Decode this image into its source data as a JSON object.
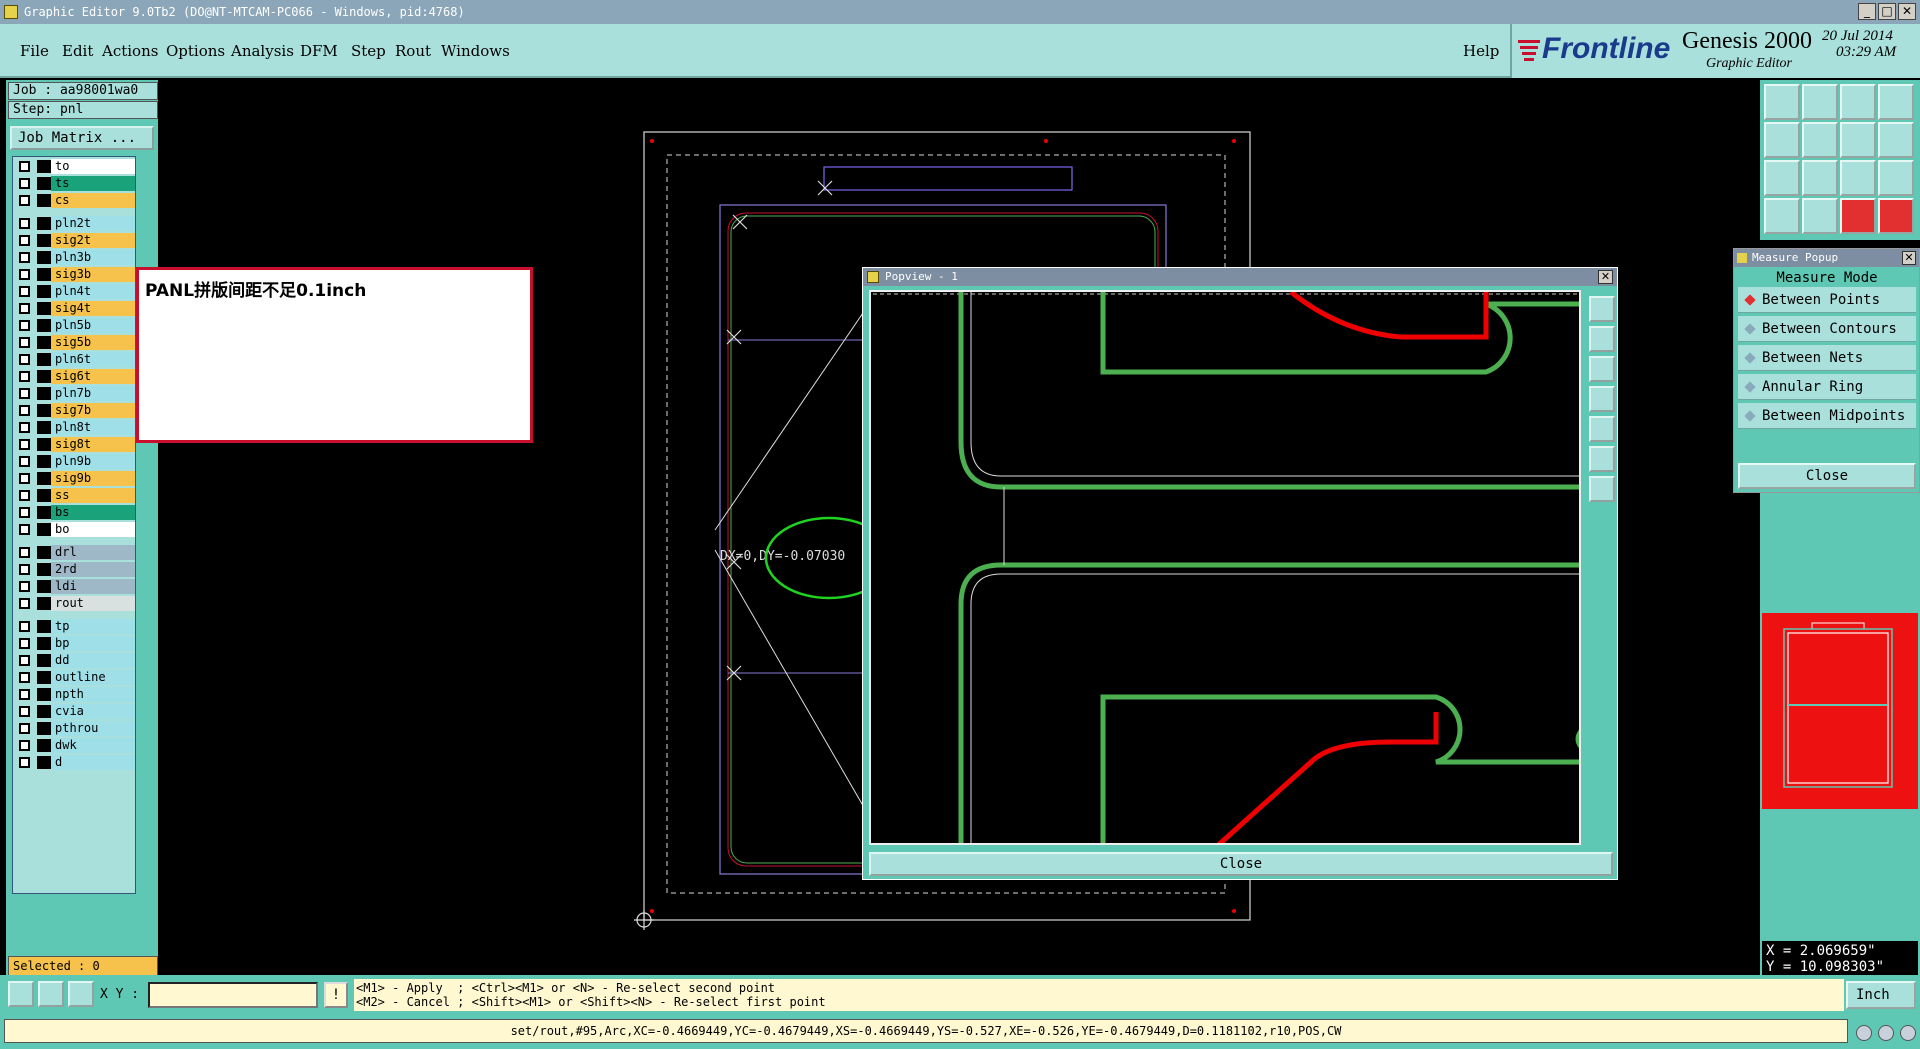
{
  "window": {
    "title": "Graphic Editor 9.0Tb2 (DO@NT-MTCAM-PC066 - Windows, pid:4768)"
  },
  "menu": {
    "items": [
      "File",
      "Edit",
      "Actions",
      "Options",
      "Analysis",
      "DFM",
      "Step",
      "Rout",
      "Windows"
    ],
    "help": "Help"
  },
  "brand": {
    "logo": "Frontline",
    "product": "Genesis 2000",
    "subtitle": "Graphic Editor",
    "date": "20 Jul 2014",
    "time": "03:29 AM"
  },
  "job": {
    "job_label": "Job : aa98001wa0",
    "step_label": "Step: pnl",
    "matrix_button": "Job Matrix ..."
  },
  "layers": [
    {
      "name": "to",
      "color": "#ffffff"
    },
    {
      "name": "ts",
      "color": "#1aa37a"
    },
    {
      "name": "cs",
      "color": "#f6c24c"
    },
    {
      "name": "pln2t",
      "color": "#9fdfe8"
    },
    {
      "name": "sig2t",
      "color": "#f6c24c"
    },
    {
      "name": "pln3b",
      "color": "#9fdfe8"
    },
    {
      "name": "sig3b",
      "color": "#f6c24c"
    },
    {
      "name": "pln4t",
      "color": "#9fdfe8"
    },
    {
      "name": "sig4t",
      "color": "#f6c24c"
    },
    {
      "name": "pln5b",
      "color": "#9fdfe8"
    },
    {
      "name": "sig5b",
      "color": "#f6c24c"
    },
    {
      "name": "pln6t",
      "color": "#9fdfe8"
    },
    {
      "name": "sig6t",
      "color": "#f6c24c"
    },
    {
      "name": "pln7b",
      "color": "#9fdfe8"
    },
    {
      "name": "sig7b",
      "color": "#f6c24c"
    },
    {
      "name": "pln8t",
      "color": "#9fdfe8"
    },
    {
      "name": "sig8t",
      "color": "#f6c24c"
    },
    {
      "name": "pln9b",
      "color": "#9fdfe8"
    },
    {
      "name": "sig9b",
      "color": "#f6c24c"
    },
    {
      "name": "ss",
      "color": "#f6c24c"
    },
    {
      "name": "bs",
      "color": "#1aa37a"
    },
    {
      "name": "bo",
      "color": "#ffffff"
    },
    {
      "name": "drl",
      "color": "#9fb8c8"
    },
    {
      "name": "2rd",
      "color": "#9fb8c8"
    },
    {
      "name": "ldi",
      "color": "#9fb8c8"
    },
    {
      "name": "rout",
      "color": "#d8e0e0"
    },
    {
      "name": "tp",
      "color": "#9fdfe8"
    },
    {
      "name": "bp",
      "color": "#9fdfe8"
    },
    {
      "name": "dd",
      "color": "#9fdfe8"
    },
    {
      "name": "outline",
      "color": "#9fdfe8"
    },
    {
      "name": "npth",
      "color": "#9fdfe8"
    },
    {
      "name": "cvia",
      "color": "#9fdfe8"
    },
    {
      "name": "pthrou",
      "color": "#9fdfe8"
    },
    {
      "name": "dwk",
      "color": "#9fdfe8"
    },
    {
      "name": "d",
      "color": "#9fdfe8"
    }
  ],
  "selected": "Selected : 0",
  "annotation": "PANL拼版间距不足0.1inch",
  "measure_readout": "DX=0,DY=-0.07030",
  "popview": {
    "title": "Popview - 1",
    "close": "Close"
  },
  "measure_popup": {
    "title": "Measure Popup",
    "header": "Measure Mode",
    "options": [
      "Between Points",
      "Between Contours",
      "Between Nets",
      "Annular Ring",
      "Between Midpoints"
    ],
    "active_option": "Between Points",
    "close": "Close"
  },
  "coords": {
    "x": "X = 2.069659\"",
    "y": "Y = 10.098303\""
  },
  "bottom": {
    "xy_label": "X Y :",
    "bang": "!",
    "hint_line1": "<M1> - Apply  ; <Ctrl><M1> or <N> - Re-select second point",
    "hint_line2": "<M2> - Cancel ; <Shift><M1> or <Shift><N> - Re-select first point",
    "unit": "Inch"
  },
  "status": "set/rout,#95,Arc,XC=-0.4669449,YC=-0.4679449,XS=-0.4669449,YS=-0.527,XE=-0.526,YE=-0.4679449,D=0.1181102,r10,POS,CW"
}
